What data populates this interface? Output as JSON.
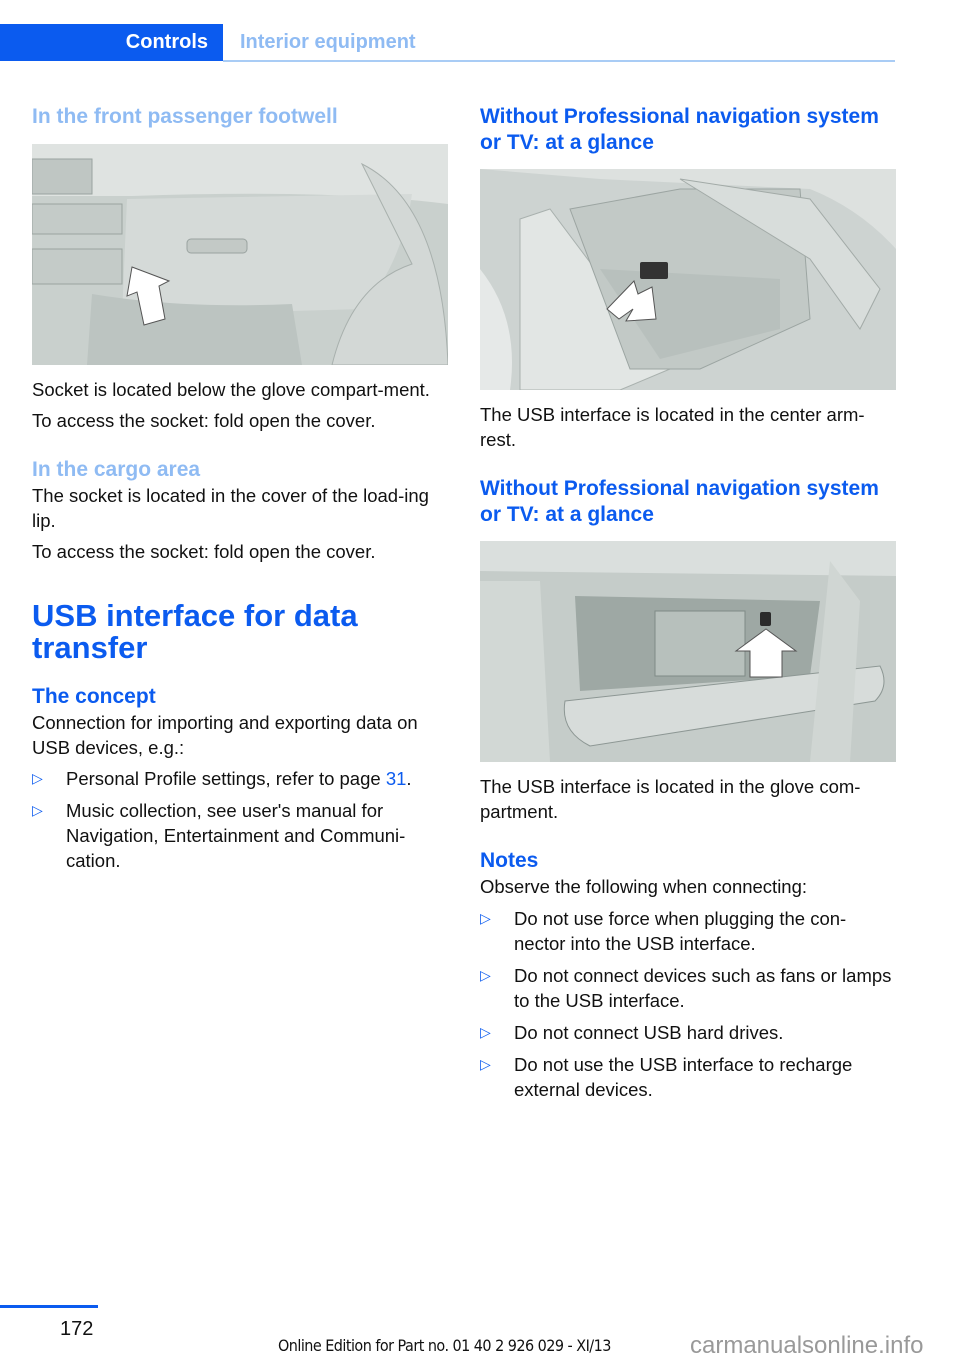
{
  "header": {
    "section": "Controls",
    "subsection": "Interior equipment"
  },
  "left": {
    "footwell_heading": "In the front passenger footwell",
    "footwell_figure": "glove-compartment-footwell-illustration",
    "footwell_p1": "Socket is located below the glove compart-ment.",
    "footwell_p2": "To access the socket: fold open the cover.",
    "cargo_heading": "In the cargo area",
    "cargo_p1": "The socket is located in the cover of the load-ing lip.",
    "cargo_p2": "To access the socket: fold open the cover.",
    "usb_heading": "USB interface for data transfer",
    "concept_heading": "The concept",
    "concept_p": "Connection for importing and exporting data on USB devices, e.g.:",
    "bullets": [
      {
        "text": "Personal Profile settings, refer to page ",
        "link": "31",
        "after": "."
      },
      {
        "text": "Music collection, see user's manual for Navigation, Entertainment and Communi-cation.",
        "link": "",
        "after": ""
      }
    ]
  },
  "right": {
    "heading1": "Without Professional navigation system or TV: at a glance",
    "figure1": "center-armrest-usb-illustration",
    "p1": "The USB interface is located in the center arm-rest.",
    "heading2": "Without Professional navigation system or TV: at a glance",
    "figure2": "glove-compartment-usb-illustration",
    "p2": "The USB interface is located in the glove com-partment.",
    "notes_heading": "Notes",
    "notes_p": "Observe the following when connecting:",
    "notes": [
      "Do not use force when plugging the con-nector into the USB interface.",
      "Do not connect devices such as fans or lamps to the USB interface.",
      "Do not connect USB hard drives.",
      "Do not use the USB interface to recharge external devices."
    ]
  },
  "footer": {
    "page_number": "172",
    "edition": "Online Edition for Part no. 01 40 2 926 029 - XI/13",
    "watermark": "carmanualsonline.info"
  },
  "icons": {
    "bullet": "▷"
  }
}
